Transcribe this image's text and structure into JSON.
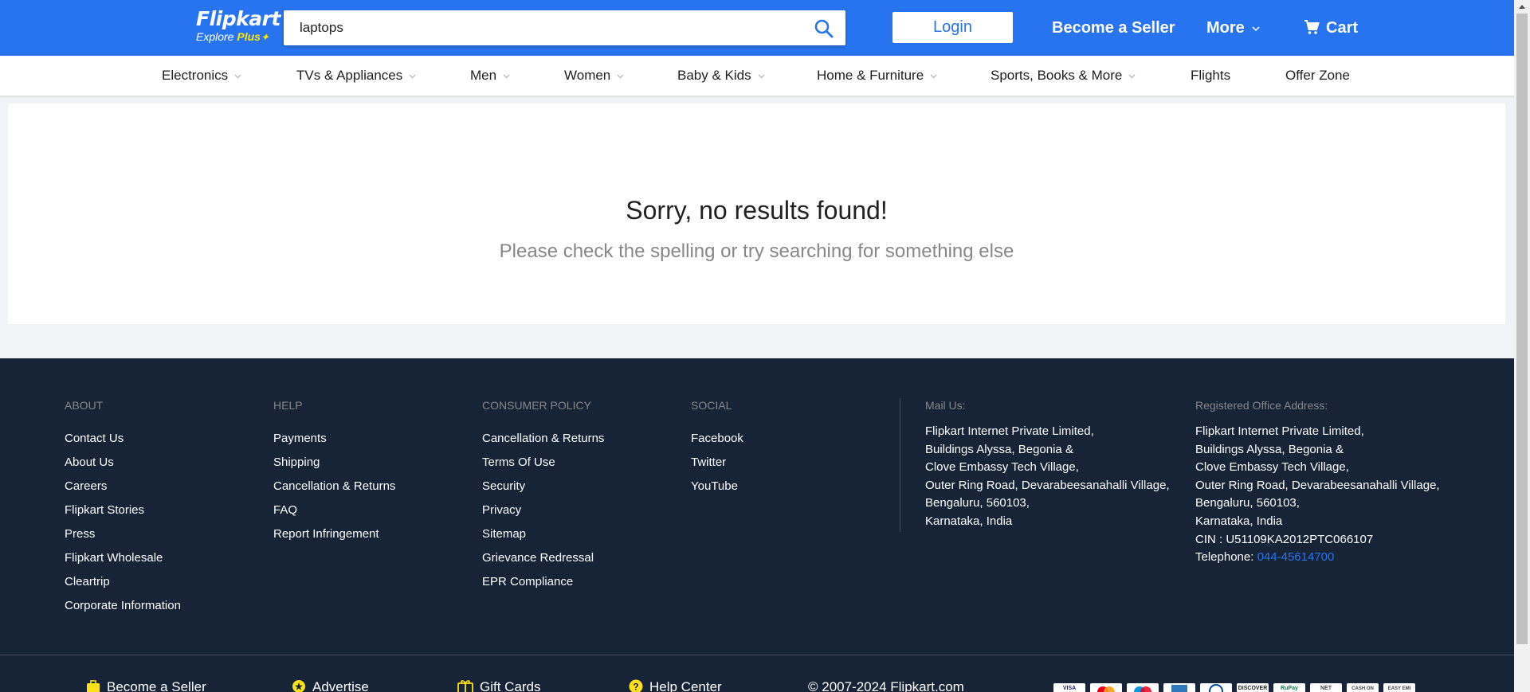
{
  "header": {
    "logo_text": "Flipkart",
    "logo_sub": "Explore",
    "logo_plus": "Plus",
    "search_value": "laptops",
    "login_label": "Login",
    "become_seller_label": "Become a Seller",
    "more_label": "More",
    "cart_label": "Cart"
  },
  "categories": [
    {
      "label": "Electronics"
    },
    {
      "label": "TVs & Appliances"
    },
    {
      "label": "Men"
    },
    {
      "label": "Women"
    },
    {
      "label": "Baby & Kids"
    },
    {
      "label": "Home & Furniture"
    },
    {
      "label": "Sports, Books & More"
    },
    {
      "label": "Flights"
    },
    {
      "label": "Offer Zone"
    }
  ],
  "results": {
    "title": "Sorry, no results found!",
    "subtitle": "Please check the spelling or try searching for something else"
  },
  "footer": {
    "about": {
      "heading": "ABOUT",
      "links": [
        "Contact Us",
        "About Us",
        "Careers",
        "Flipkart Stories",
        "Press",
        "Flipkart Wholesale",
        "Cleartrip",
        "Corporate Information"
      ]
    },
    "help": {
      "heading": "HELP",
      "links": [
        "Payments",
        "Shipping",
        "Cancellation & Returns",
        "FAQ",
        "Report Infringement"
      ]
    },
    "policy": {
      "heading": "CONSUMER POLICY",
      "links": [
        "Cancellation & Returns",
        "Terms Of Use",
        "Security",
        "Privacy",
        "Sitemap",
        "Grievance Redressal",
        "EPR Compliance"
      ]
    },
    "social": {
      "heading": "SOCIAL",
      "links": [
        "Facebook",
        "Twitter",
        "YouTube"
      ]
    },
    "mail": {
      "heading": "Mail Us:",
      "lines": [
        "Flipkart Internet Private Limited,",
        "Buildings Alyssa, Begonia &",
        "Clove Embassy Tech Village,",
        "Outer Ring Road, Devarabeesanahalli Village,",
        "Bengaluru, 560103,",
        "Karnataka, India"
      ]
    },
    "office": {
      "heading": "Registered Office Address:",
      "lines": [
        "Flipkart Internet Private Limited,",
        "Buildings Alyssa, Begonia &",
        "Clove Embassy Tech Village,",
        "Outer Ring Road, Devarabeesanahalli Village,",
        "Bengaluru, 560103,",
        "Karnataka, India",
        "CIN : U51109KA2012PTC066107"
      ],
      "telephone_label": "Telephone: ",
      "telephone": "044-45614700"
    },
    "bottom": {
      "become_seller": "Become a Seller",
      "advertise": "Advertise",
      "gift_cards": "Gift Cards",
      "help_center": "Help Center",
      "copyright": "© 2007-2024 Flipkart.com"
    },
    "payment_methods": [
      "VISA",
      "Mastercard",
      "Maestro",
      "AMEX",
      "Diners",
      "DISCOVER",
      "RuPay",
      "NET",
      "CASH ON",
      "EASY EMI"
    ]
  },
  "colors": {
    "brand_blue": "#2874f0",
    "footer_bg": "#172337",
    "accent_yellow": "#ffe500"
  }
}
